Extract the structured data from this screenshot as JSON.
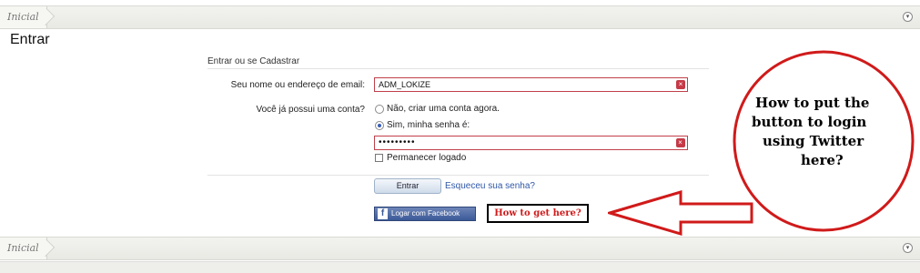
{
  "breadcrumb": {
    "home_label": "Inicial",
    "jump_icon": "chevron-down-icon"
  },
  "page": {
    "title": "Entrar"
  },
  "form": {
    "heading": "Entrar ou se Cadastrar",
    "email_label": "Seu nome ou endereço de email:",
    "email_value": "ADM_LOKIZE",
    "account_label": "Você já possui uma conta?",
    "option_no": "Não, criar uma conta agora.",
    "option_yes": "Sim, minha senha é:",
    "selected_option": "yes",
    "password_value": "•••••••••",
    "remember_label": "Permanecer logado",
    "remember_checked": false,
    "submit_label": "Entrar",
    "forgot_label": "Esqueceu sua senha?",
    "facebook_label": "Logar com Facebook",
    "clear_icon": "clear-icon",
    "facebook_icon": "facebook-icon"
  },
  "annotations": {
    "box_text": "How to get here?",
    "bubble_lines": [
      "How to put the",
      "button to login",
      "using Twitter",
      "here?"
    ],
    "accent_color": "#d01a1a"
  }
}
